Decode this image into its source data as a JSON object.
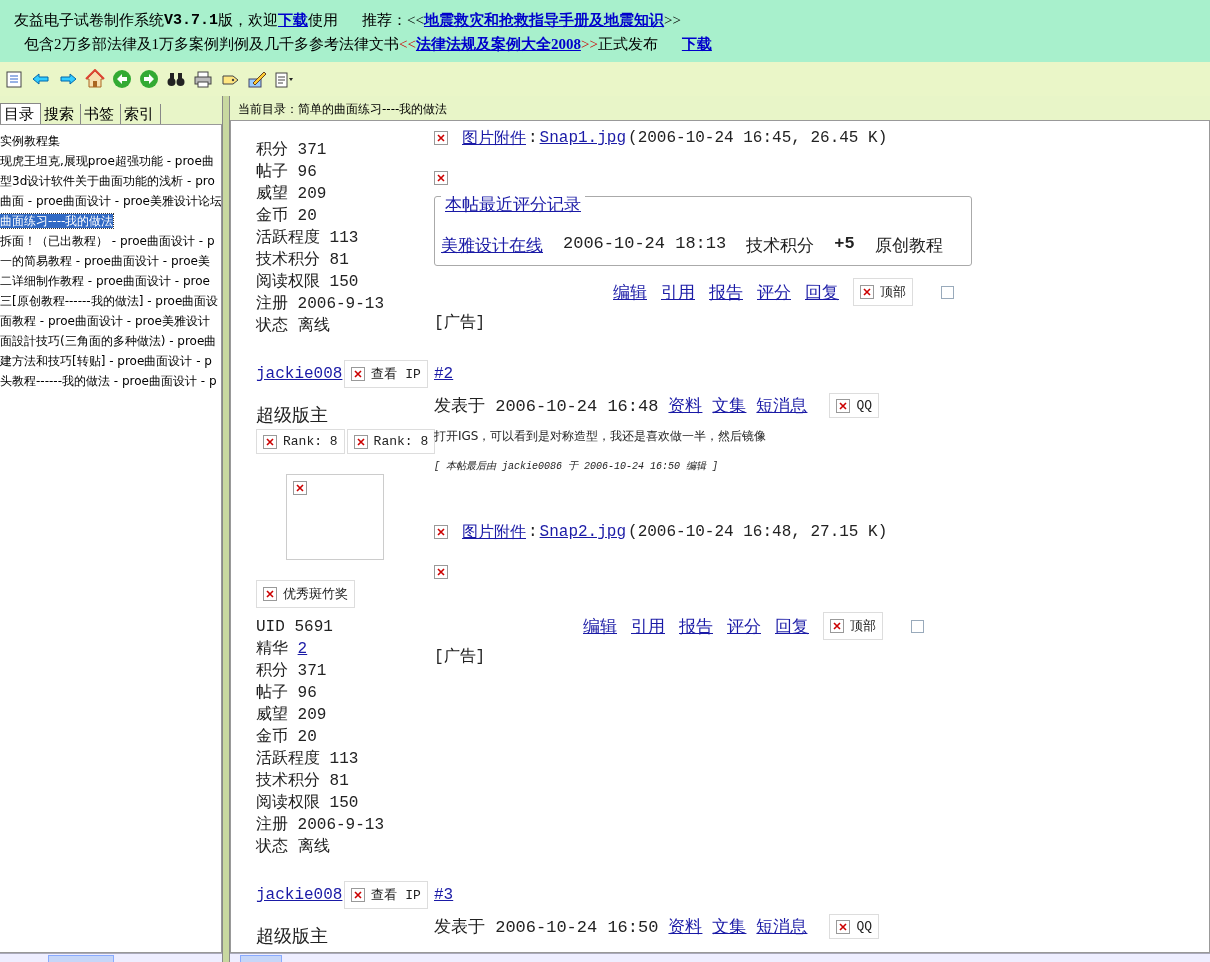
{
  "banner": {
    "lines": [
      [
        {
          "kind": "text",
          "text": "友益电子试卷制作系统 "
        },
        {
          "kind": "bold",
          "text": "V3.7.1"
        },
        {
          "kind": "text",
          "text": "版，欢迎"
        },
        {
          "kind": "link",
          "text": "下载"
        },
        {
          "kind": "text",
          "text": "使用"
        },
        {
          "kind": "gap"
        },
        {
          "kind": "text",
          "text": "推荐：<<"
        },
        {
          "kind": "link",
          "text": "地震救灾和抢救指导手册及地震知识"
        },
        {
          "kind": "text",
          "text": ">>"
        }
      ],
      [
        {
          "kind": "text",
          "text": "包含2万多部法律及1万多案例判例及几千多参考法律文书"
        },
        {
          "kind": "red",
          "text": "<<"
        },
        {
          "kind": "link",
          "text": "法律法规及案例大全2008"
        },
        {
          "kind": "red",
          "text": ">>"
        },
        {
          "kind": "text",
          "text": "正式发布"
        },
        {
          "kind": "gap"
        },
        {
          "kind": "link",
          "text": "下载"
        }
      ]
    ]
  },
  "sidebar": {
    "tabs": [
      {
        "label": "目录",
        "selected": true
      },
      {
        "label": "搜索",
        "selected": false
      },
      {
        "label": "书签",
        "selected": false
      },
      {
        "label": "索引",
        "selected": false
      }
    ],
    "items": [
      {
        "label": "实例教程集",
        "selected": false
      },
      {
        "label": "现虎王坦克,展现proe超强功能 - proe曲",
        "selected": false
      },
      {
        "label": "型3d设计软件关于曲面功能的浅析 - pro",
        "selected": false
      },
      {
        "label": "曲面 - proe曲面设计 - proe美雅设计论坛",
        "selected": false
      },
      {
        "label": "曲面练习----我的做法",
        "selected": true
      },
      {
        "label": "拆面！（已出教程） - proe曲面设计 - p",
        "selected": false
      },
      {
        "label": "一的简易教程 - proe曲面设计 - proe美",
        "selected": false
      },
      {
        "label": "二详细制作教程 - proe曲面设计 - proe",
        "selected": false
      },
      {
        "label": "三[原创教程------我的做法] - proe曲面设",
        "selected": false
      },
      {
        "label": "面教程 - proe曲面设计 - proe美雅设计",
        "selected": false
      },
      {
        "label": "面設計技巧(三角面的多种做法) - proe曲",
        "selected": false
      },
      {
        "label": "建方法和技巧[转贴] - proe曲面设计 - p",
        "selected": false
      },
      {
        "label": "头教程------我的做法 - proe曲面设计 - p",
        "selected": false
      }
    ]
  },
  "content": {
    "path": "当前目录：简单的曲面练习----我的做法",
    "top_block": {
      "stats": [
        {
          "label": "积分",
          "value": "371"
        },
        {
          "label": "帖子",
          "value": "96"
        },
        {
          "label": "威望",
          "value": "209"
        },
        {
          "label": "金币",
          "value": "20"
        },
        {
          "label": "活跃程度",
          "value": "113"
        },
        {
          "label": "技术积分",
          "value": "81"
        },
        {
          "label": "阅读权限",
          "value": "150"
        },
        {
          "label": "注册",
          "value": "2006-9-13"
        },
        {
          "label": "状态",
          "value": "离线"
        }
      ],
      "attachment": {
        "label": "图片附件",
        "sep": ":",
        "file": "Snap1.jpg",
        "meta": "(2006-10-24 16:45, 26.45 K)"
      },
      "rating": {
        "title": "本帖最近评分记录",
        "user": "美雅设计在线",
        "time": "2006-10-24 18:13",
        "item": "技术积分",
        "score": "+5",
        "reason": "原创教程"
      },
      "actions": [
        "编辑",
        "引用",
        "报告",
        "评分",
        "回复"
      ],
      "top_button": "顶部",
      "checked": false,
      "ad": "[广告]"
    },
    "posts": [
      {
        "number": "#2",
        "username": "jackie008",
        "ip_button": "查看 IP",
        "role": "超级版主",
        "ranks": [
          "Rank: 8",
          "Rank: 8"
        ],
        "medal": "优秀斑竹奖",
        "stats": [
          {
            "label": "UID",
            "value": "5691"
          },
          {
            "label": "精华",
            "value": "2",
            "link": true
          },
          {
            "label": "积分",
            "value": "371"
          },
          {
            "label": "帖子",
            "value": "96"
          },
          {
            "label": "威望",
            "value": "209"
          },
          {
            "label": "金币",
            "value": "20"
          },
          {
            "label": "活跃程度",
            "value": "113"
          },
          {
            "label": "技术积分",
            "value": "81"
          },
          {
            "label": "阅读权限",
            "value": "150"
          },
          {
            "label": "注册",
            "value": "2006-9-13"
          },
          {
            "label": "状态",
            "value": "离线"
          }
        ],
        "posted": "发表于 2006-10-24 16:48",
        "links": [
          "资料",
          "文集",
          "短消息"
        ],
        "qq": "QQ",
        "message": "打开IGS，可以看到是对称造型，我还是喜欢做一半，然后镜像",
        "edit_note": "[ 本帖最后由 jackie0086 于 2006-10-24 16:50 编辑 ]",
        "attachment": {
          "label": "图片附件",
          "sep": ":",
          "file": "Snap2.jpg",
          "meta": "(2006-10-24 16:48, 27.15 K)"
        },
        "actions": [
          "编辑",
          "引用",
          "报告",
          "评分",
          "回复"
        ],
        "top_button": "顶部",
        "checked": false,
        "ad": "[广告]"
      },
      {
        "number": "#3",
        "username": "jackie008",
        "ip_button": "查看 IP",
        "role": "超级版主",
        "posted": "发表于 2006-10-24 16:50",
        "links": [
          "资料",
          "文集",
          "短消息"
        ],
        "qq": "QQ"
      }
    ]
  }
}
